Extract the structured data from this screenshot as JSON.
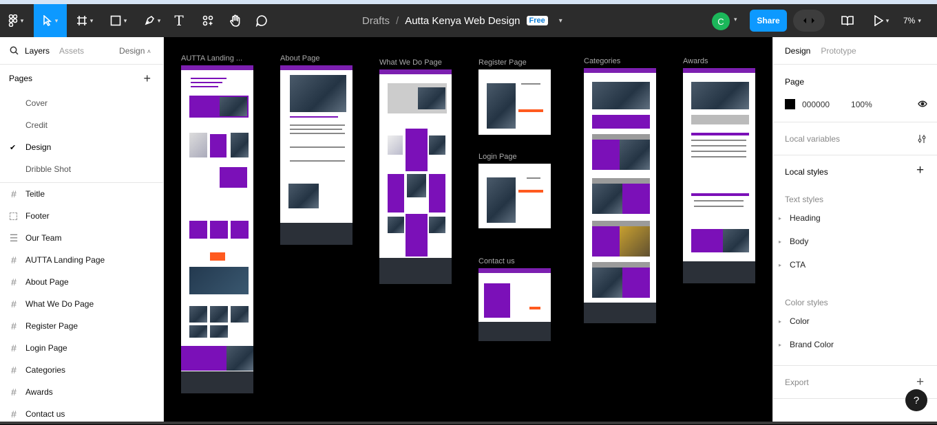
{
  "toolbar": {
    "breadcrumb_parent": "Drafts",
    "breadcrumb_sep": "/",
    "file_title": "Autta Kenya Web Design",
    "plan_badge": "Free",
    "avatar_initial": "C",
    "share_label": "Share",
    "zoom": "7%",
    "text_tool": "T"
  },
  "left_panel": {
    "tabs": {
      "layers": "Layers",
      "assets": "Assets",
      "design": "Design"
    },
    "pages_title": "Pages",
    "pages": [
      {
        "label": "Cover"
      },
      {
        "label": "Credit"
      },
      {
        "label": "Design",
        "current": true
      },
      {
        "label": "Dribble Shot"
      }
    ],
    "layers": [
      {
        "label": "Teitle",
        "icon": "frame-icon"
      },
      {
        "label": "Footer",
        "icon": "dashed-frame-icon"
      },
      {
        "label": "Our Team",
        "icon": "auto-layout-icon"
      },
      {
        "label": "AUTTA Landing Page",
        "icon": "frame-icon"
      },
      {
        "label": "About Page",
        "icon": "frame-icon"
      },
      {
        "label": "What We Do Page",
        "icon": "frame-icon"
      },
      {
        "label": "Register Page",
        "icon": "frame-icon"
      },
      {
        "label": "Login Page",
        "icon": "frame-icon"
      },
      {
        "label": "Categories",
        "icon": "frame-icon"
      },
      {
        "label": "Awards",
        "icon": "frame-icon"
      },
      {
        "label": "Contact us",
        "icon": "frame-icon"
      }
    ]
  },
  "canvas": {
    "frames": [
      {
        "label": "AUTTA  Landing ..."
      },
      {
        "label": "About Page"
      },
      {
        "label": "What We Do Page"
      },
      {
        "label": "Register  Page"
      },
      {
        "label": "Login Page"
      },
      {
        "label": "Contact us"
      },
      {
        "label": "Categories"
      },
      {
        "label": "Awards"
      }
    ]
  },
  "right_panel": {
    "tabs": {
      "design": "Design",
      "prototype": "Prototype"
    },
    "page_title": "Page",
    "page_color": "000000",
    "page_opacity": "100%",
    "local_variables": "Local variables",
    "local_styles": "Local styles",
    "text_styles_title": "Text styles",
    "text_styles": [
      "Heading",
      "Body",
      "CTA"
    ],
    "color_styles_title": "Color styles",
    "color_styles": [
      "Color",
      "Brand Color"
    ],
    "export": "Export",
    "help": "?"
  },
  "colors": {
    "accent": "#0d99ff",
    "brand_purple": "#7b10b8",
    "toolbar_bg": "#2c2c2c"
  }
}
